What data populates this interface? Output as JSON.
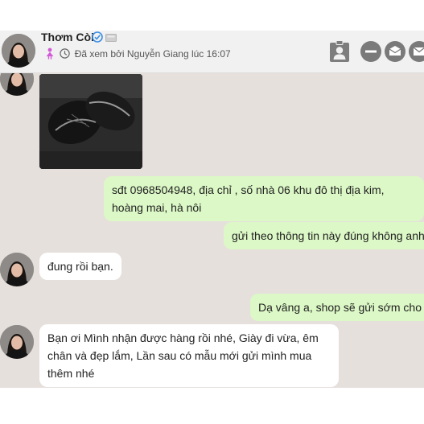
{
  "header": {
    "contact_name": "Thơm Còi",
    "seen_status": "Đã xem bởi Nguyễn Giang lúc 16:07",
    "icons": [
      "verified-icon",
      "mobile-icon",
      "female-icon",
      "clock-icon",
      "contact-card-icon",
      "block-icon",
      "message-icon",
      "email-icon"
    ]
  },
  "messages": [
    {
      "sender": "contact",
      "type": "image"
    },
    {
      "sender": "me",
      "text": "sđt 0968504948, địa chỉ , số nhà 06 khu đô thị địa kim, hoàng mai, hà nôi"
    },
    {
      "sender": "me",
      "text": "gửi theo thông tin này đúng không anh"
    },
    {
      "sender": "contact",
      "text": "đung rồi bạn."
    },
    {
      "sender": "me",
      "text": "Dạ vâng a, shop sẽ gửi sớm cho a"
    },
    {
      "sender": "contact",
      "text": "Bạn ơi Mình nhận được hàng rồi nhé, Giày đi vừa, êm chân và đẹp lắm, Lần sau có mẫu mới gửi mình mua thêm nhé"
    }
  ],
  "colors": {
    "chat_background": "#e6e0dc",
    "outgoing_bubble": "#dcf8c6",
    "incoming_bubble": "#ffffff",
    "header_background": "#f1f1f1"
  }
}
